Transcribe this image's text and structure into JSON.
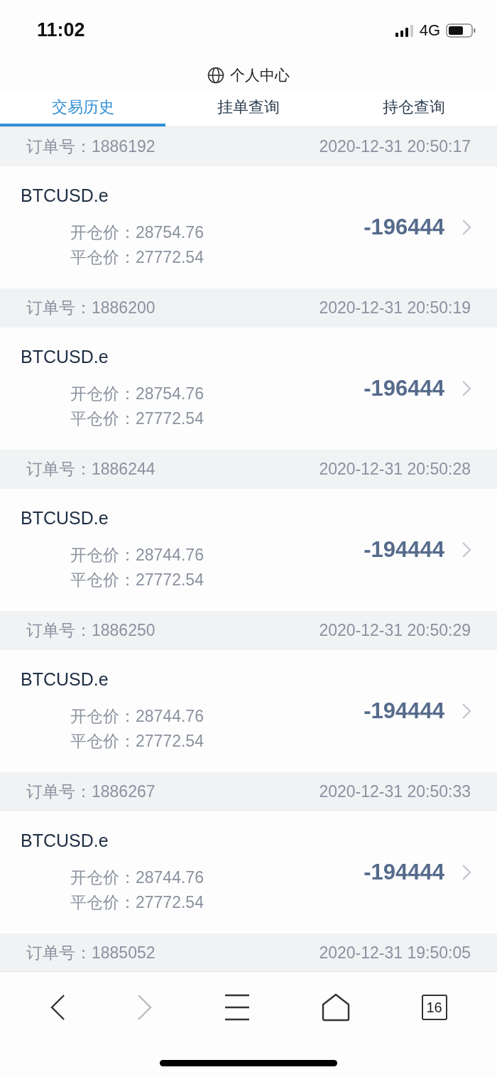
{
  "status_bar": {
    "time": "11:02",
    "network": "4G"
  },
  "title": "个人中心",
  "tabs": [
    {
      "label": "交易历史",
      "selected": true
    },
    {
      "label": "挂单查询",
      "selected": false
    },
    {
      "label": "持仓查询",
      "selected": false
    }
  ],
  "orders": [
    {
      "order_label": "订单号：",
      "order_no": "1886192",
      "time": "2020-12-31 20:50:17",
      "symbol": "BTCUSD.e",
      "open_label": "开仓价：",
      "open_price": "28754.76",
      "close_label": "平仓价：",
      "close_price": "27772.54",
      "profit": "-196444"
    },
    {
      "order_label": "订单号：",
      "order_no": "1886200",
      "time": "2020-12-31 20:50:19",
      "symbol": "BTCUSD.e",
      "open_label": "开仓价：",
      "open_price": "28754.76",
      "close_label": "平仓价：",
      "close_price": "27772.54",
      "profit": "-196444"
    },
    {
      "order_label": "订单号：",
      "order_no": "1886244",
      "time": "2020-12-31 20:50:28",
      "symbol": "BTCUSD.e",
      "open_label": "开仓价：",
      "open_price": "28744.76",
      "close_label": "平仓价：",
      "close_price": "27772.54",
      "profit": "-194444"
    },
    {
      "order_label": "订单号：",
      "order_no": "1886250",
      "time": "2020-12-31 20:50:29",
      "symbol": "BTCUSD.e",
      "open_label": "开仓价：",
      "open_price": "28744.76",
      "close_label": "平仓价：",
      "close_price": "27772.54",
      "profit": "-194444"
    },
    {
      "order_label": "订单号：",
      "order_no": "1886267",
      "time": "2020-12-31 20:50:33",
      "symbol": "BTCUSD.e",
      "open_label": "开仓价：",
      "open_price": "28744.76",
      "close_label": "平仓价：",
      "close_price": "27772.54",
      "profit": "-194444"
    },
    {
      "order_label": "订单号：",
      "order_no": "1885052",
      "time": "2020-12-31 19:50:05"
    }
  ],
  "toolbar": {
    "forward_disabled": true,
    "tab_count": "16"
  }
}
